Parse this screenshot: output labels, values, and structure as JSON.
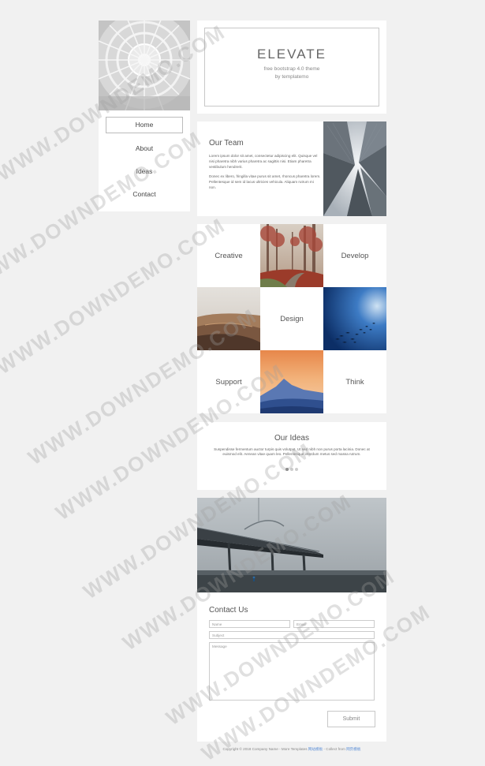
{
  "sidebar": {
    "nav": [
      {
        "label": "Home",
        "active": true
      },
      {
        "label": "About",
        "active": false
      },
      {
        "label": "Ideas",
        "active": false
      },
      {
        "label": "Contact",
        "active": false
      }
    ]
  },
  "header": {
    "brand": "ELEVATE",
    "tagline_line1": "free bootstrap 4.0 theme",
    "tagline_line2": "by templatemo"
  },
  "team": {
    "title": "Our Team",
    "paragraph1": "Lorem ipsum dolor sit amet, consectetur adipiscing elit. Quisque vel nisi pharetra nibh varius pharetra ac sagittis nisi. Etiam pharetra vestibulum hendrerit.",
    "paragraph2": "Donec ex libero, fringilla vitae purus sit amet, rhoncus pharetra lorem. Pellentesque id sem id lacus ultricies vehicula. Aliquam rutrum mi non."
  },
  "grid": {
    "creative": "Creative",
    "develop": "Develop",
    "design": "Design",
    "support": "Support",
    "think": "Think"
  },
  "ideas": {
    "title": "Our Ideas",
    "text": "Suspendisse fermentum auctor turpis quis volutpat. Ut sed nibh non purus porta lacinia. Donec at euismod elit. Aenean vitae quam leo. Pellentesque interdum metus sed massa rutrum.",
    "active_slide": 1,
    "slides": 3
  },
  "contact": {
    "title": "Contact Us",
    "name_placeholder": "Name",
    "email_placeholder": "Email",
    "subject_placeholder": "Subject",
    "message_placeholder": "Message",
    "submit_label": "Submit"
  },
  "footer": {
    "text": "Copyright © 2018 Company Name - More Templates",
    "link1": "网站模板",
    "middle": " - Collect from ",
    "link2": "网页模板"
  },
  "watermark": "WWW.DOWNDEMO.COM"
}
